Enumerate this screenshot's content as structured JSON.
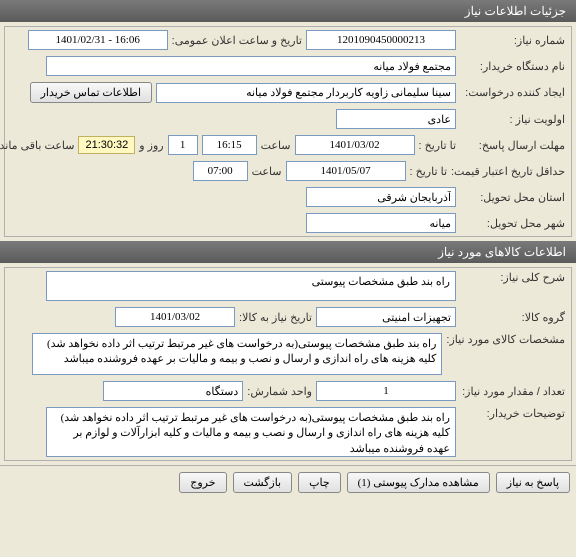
{
  "header1": {
    "title": "جزئیات اطلاعات نیاز"
  },
  "info": {
    "need_no_label": "شماره نیاز:",
    "need_no": "1201090450000213",
    "announce_label": "تاریخ و ساعت اعلان عمومی:",
    "announce_value": "1401/02/31 - 16:06",
    "buyer_label": "نام دستگاه خریدار:",
    "buyer": "مجتمع فولاد میانه",
    "creator_label": "ایجاد کننده درخواست:",
    "creator": "سینا سلیمانی زاویه کاربردار مجتمع فولاد میانه",
    "contact_btn": "اطلاعات تماس خریدار",
    "priority_label": "اولویت نیاز :",
    "priority": "عادی",
    "deadline_label": "مهلت ارسال پاسخ:",
    "to_date_label": "تا تاریخ :",
    "deadline_date": "1401/03/02",
    "time_label": "ساعت",
    "deadline_time": "16:15",
    "days_count": "1",
    "days_and": "روز و",
    "remaining_time": "21:30:32",
    "remaining_label": "ساعت باقی مانده",
    "validity_label": "حداقل تاریخ اعتبار قیمت:",
    "validity_date": "1401/05/07",
    "validity_time": "07:00",
    "province_label": "استان محل تحویل:",
    "province": "آذربایجان شرقی",
    "city_label": "شهر محل تحویل:",
    "city": "میانه"
  },
  "header2": {
    "title": "اطلاعات کالاهای مورد نیاز"
  },
  "goods": {
    "general_label": "شرح کلی نیاز:",
    "general_desc": "راه بند طبق مشخصات پیوستی",
    "group_label": "گروه کالا:",
    "group": "تجهیزات امنیتی",
    "need_date_label": "تاریخ نیاز به کالا:",
    "need_date": "1401/03/02",
    "item_desc_label": "مشخصات کالای مورد نیاز:",
    "item_desc": "راه بند طبق مشخصات پیوستی(به درخواست های غیر مرتبط ترتیب اثر داده نخواهد شد) کلیه هزینه های راه اندازی و ارسال و نصب و بیمه و مالیات بر عهده فروشنده میباشد",
    "qty_label": "تعداد / مقدار مورد نیاز:",
    "qty": "1",
    "unit_label": "واحد شمارش:",
    "unit": "دستگاه",
    "buyer_notes_label": "توضیحات خریدار:",
    "buyer_notes": "راه بند طبق مشخصات پیوستی(به درخواست های غیر مرتبط ترتیب اثر داده نخواهد شد) کلیه هزینه های راه اندازی و ارسال و نصب و بیمه و مالیات و کلیه ابزارآلات و لوازم بر عهده فروشنده میباشد"
  },
  "footer": {
    "reply": "پاسخ به نیاز",
    "attachments": "مشاهده مدارک پیوستی (1)",
    "print": "چاپ",
    "back": "بازگشت",
    "exit": "خروج"
  }
}
